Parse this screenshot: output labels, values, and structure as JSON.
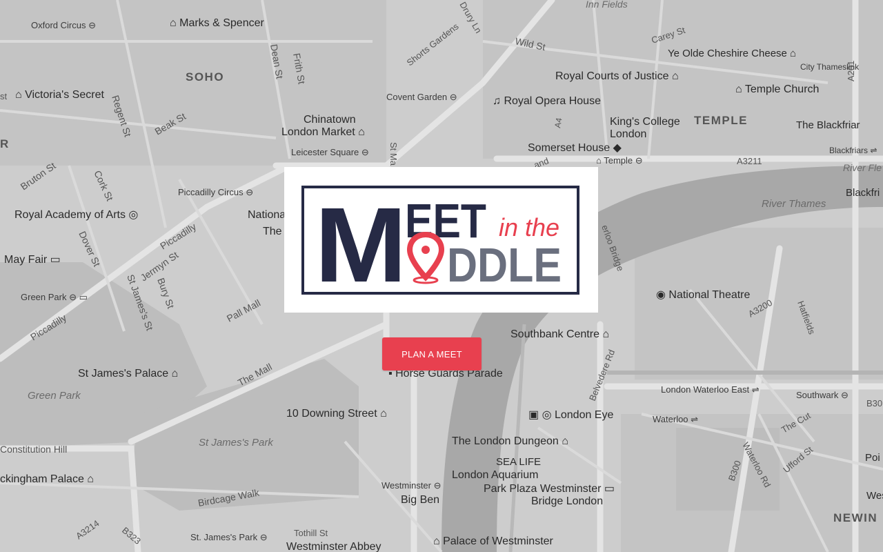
{
  "logo": {
    "word_meet": "EET",
    "letter_m": "M",
    "word_in_the": "in the",
    "word_iddle": "DDLE",
    "colors": {
      "navy": "#262a45",
      "red": "#e8404f",
      "gray": "#6a6f7e"
    }
  },
  "cta": {
    "label": "PLAN A MEET"
  },
  "map": {
    "places": [
      "Oxford Circus",
      "Marks & Spencer",
      "SOHO",
      "Victoria's Secret",
      "Regent St",
      "Dean St",
      "Frith St",
      "Beak St",
      "Chinatown",
      "London Market",
      "Leicester Square",
      "Bruton St",
      "Cork St",
      "Royal Academy of Arts",
      "Piccadilly Circus",
      "Nationa",
      "The",
      "May Fair",
      "Piccadilly",
      "Jermyn St",
      "Dover St",
      "Bury St",
      "St James's St",
      "Green Park",
      "Pall Mall",
      "St James's Palace",
      "The Mall",
      "Horse Guards Parade",
      "10 Downing Street",
      "St James's Park",
      "Constitution Hill",
      "ckingham Palace",
      "Birdcage Walk",
      "A3214",
      "B323",
      "St. James's Park",
      "Tothill St",
      "Westminster Abbey",
      "Westminster",
      "Big Ben",
      "Palace of Westminster",
      "Inn Fields",
      "Drury Ln",
      "Shorts Gardens",
      "Wild St",
      "Carey St",
      "Ye Olde Cheshire Cheese",
      "City Thameslink",
      "Royal Courts of Justice",
      "Temple Church",
      "Covent Garden",
      "Royal Opera House",
      "TEMPLE",
      "The Blackfriar",
      "A4",
      "King's College",
      "London",
      "Somerset House",
      "Temple",
      "Blackfriars",
      "A3211",
      "River Fle",
      "Blackfri",
      "River Thames",
      "erloo Bridge",
      "National Theatre",
      "A3200",
      "Hatfields",
      "Southbank Centre",
      "Belvedere Rd",
      "London Waterloo East",
      "Southwark",
      "B30",
      "London Eye",
      "Waterloo",
      "The Cut",
      "The London Dungeon",
      "SEA LIFE",
      "London Aquarium",
      "Park Plaza Westminster",
      "Bridge London",
      "Waterloo Rd",
      "Ufford St",
      "B300",
      "Wes",
      "Poi",
      "NEWIN",
      "St Ma",
      "and",
      "A201",
      "Green Park",
      "R",
      "st"
    ]
  }
}
